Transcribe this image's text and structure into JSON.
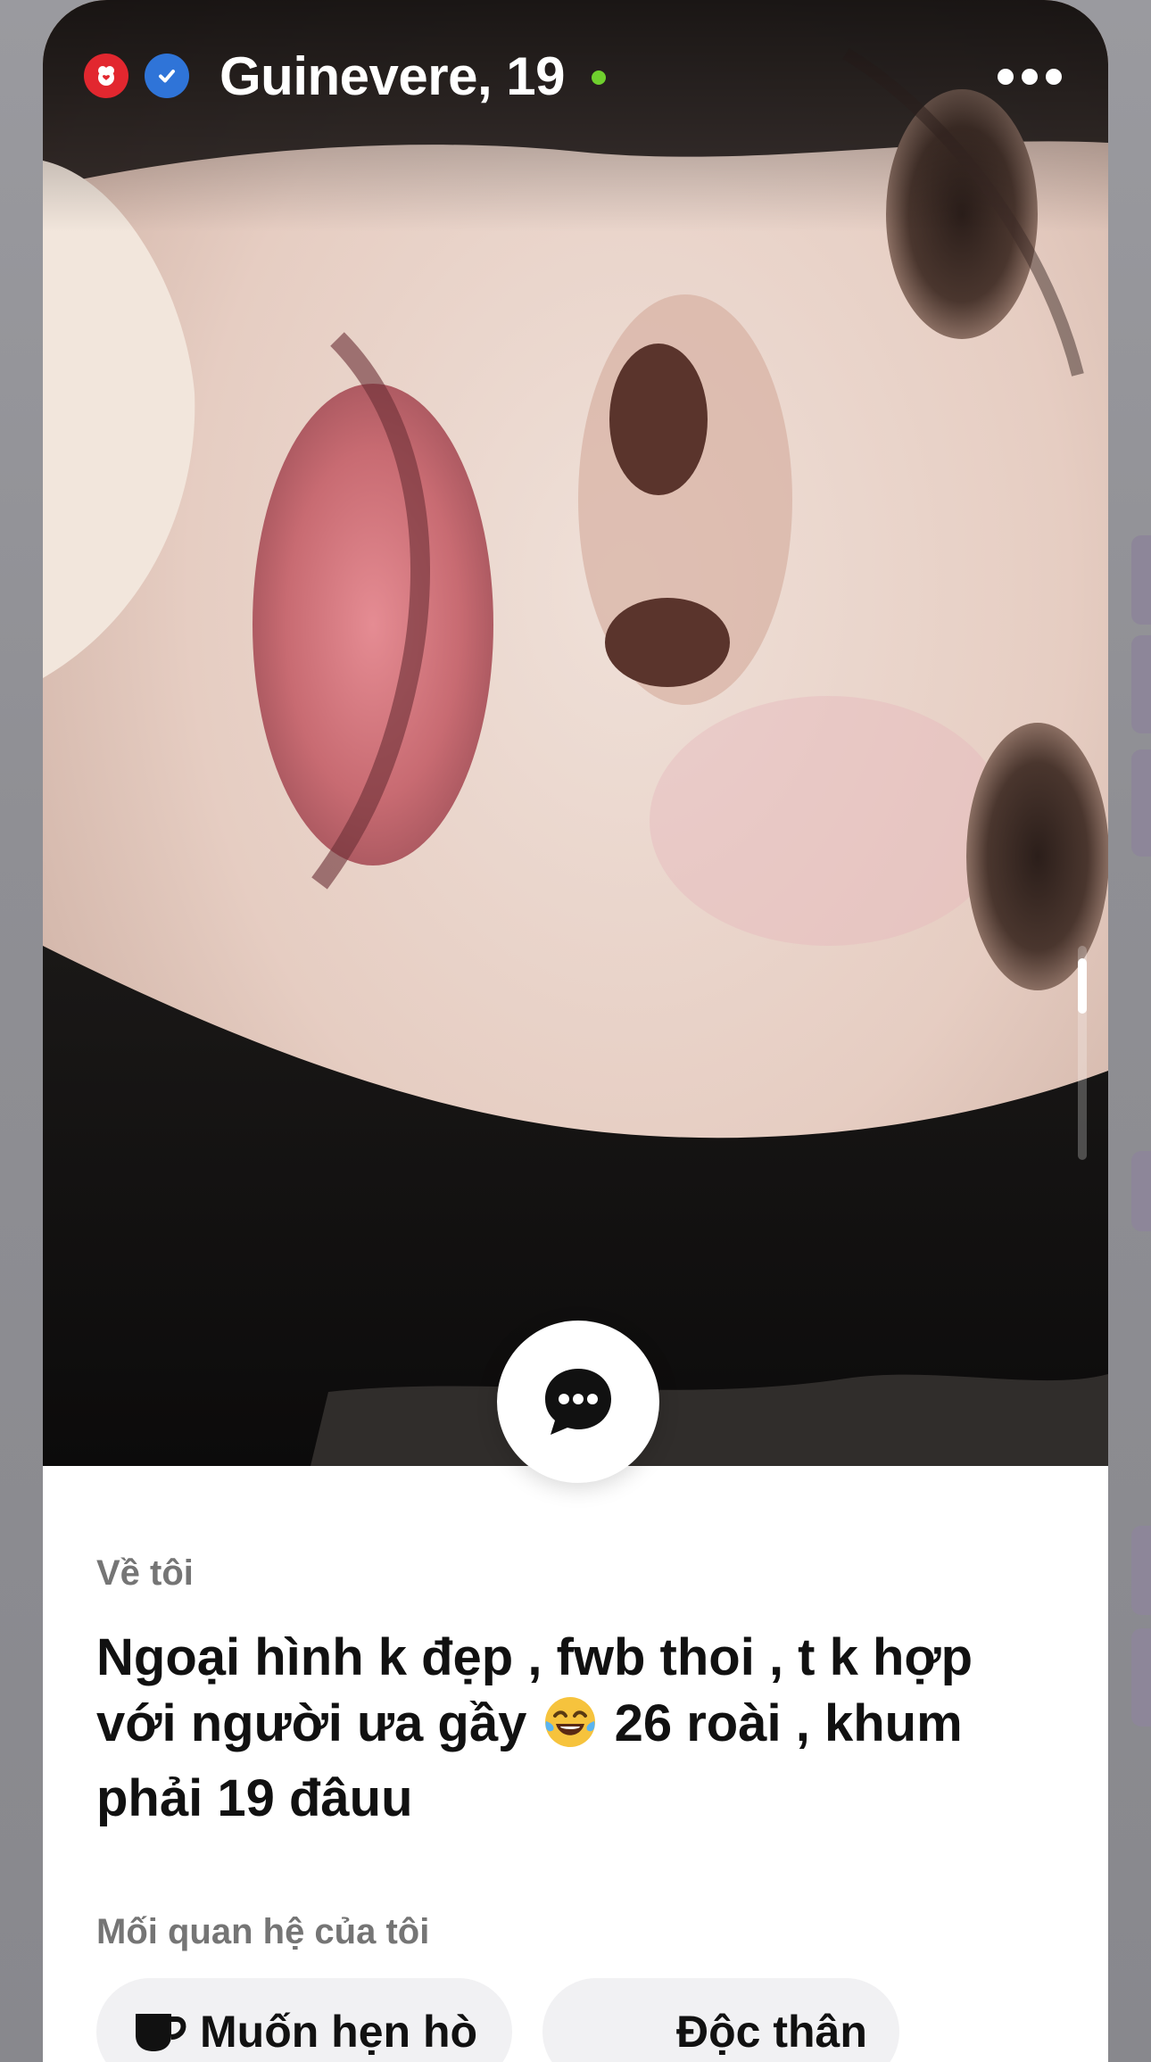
{
  "profile": {
    "name_age": "Guinevere, 19",
    "online": true,
    "badges": [
      "heart-badge-icon",
      "verified-badge-icon"
    ]
  },
  "about": {
    "label": "Về tôi",
    "lines": [
      "Ngoại hình k đẹp , fwb thoi , t k hợp",
      "với người ưa gầy",
      "26 roài , khum",
      "phải 19 đâuu"
    ]
  },
  "relationship": {
    "label": "Mối quan hệ của tôi",
    "chips": [
      {
        "label": "Muốn hẹn hò",
        "icon": "coffee-cup-icon"
      },
      {
        "label": "Độc thân",
        "icon": ""
      }
    ]
  },
  "colors": {
    "heart_badge": "#e2272f",
    "verified_badge": "#2f74d8",
    "online_dot": "#6fcf2e",
    "chip_bg": "#f1f1f3"
  }
}
